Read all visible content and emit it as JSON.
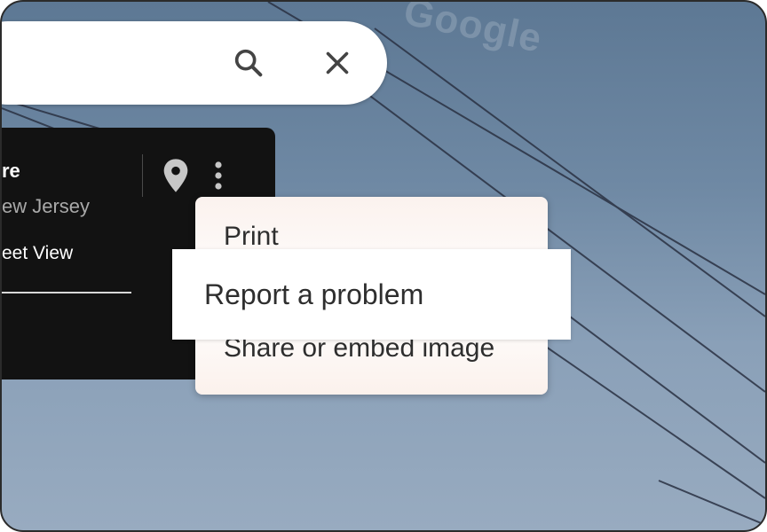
{
  "watermark": "Google",
  "search": {
    "search_icon": "search-icon",
    "close_icon": "close-icon"
  },
  "place_card": {
    "title": "re",
    "subtitle": "ew Jersey",
    "street_view_label": "eet View",
    "pin_icon": "map-pin-icon",
    "more_icon": "more-vert-icon"
  },
  "menu": {
    "items": [
      "Print",
      "Report a problem",
      "Share or embed image"
    ],
    "highlighted_index": 1
  },
  "colors": {
    "sky_top": "#5d7894",
    "sky_bottom": "#98abc0",
    "card_bg": "#121212",
    "menu_text": "#2e2e2e"
  }
}
